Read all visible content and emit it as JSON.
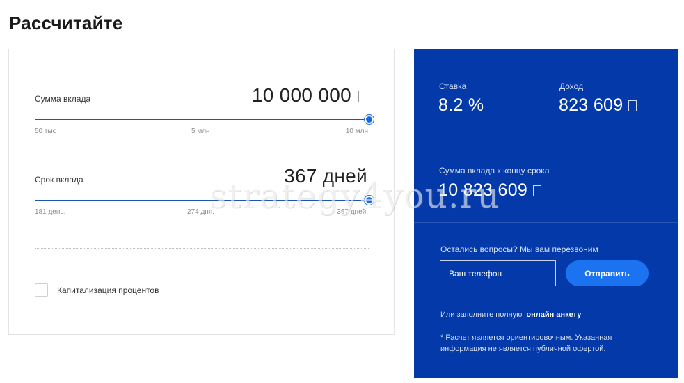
{
  "page": {
    "title": "Рассчитайте"
  },
  "deposit_amount": {
    "label": "Сумма вклада",
    "value": "10 000 000",
    "slider_fraction": 1.0,
    "ticks": [
      "50 тыс",
      "5 млн",
      "10 млн"
    ]
  },
  "deposit_term": {
    "label": "Срок вклада",
    "value": "367 дней",
    "slider_fraction": 1.0,
    "ticks": [
      "181 день.",
      "274 дня.",
      "367 дней."
    ]
  },
  "capitalization": {
    "label": "Капитализация процентов",
    "checked": false
  },
  "results": {
    "rate_label": "Ставка",
    "rate_value": "8.2 %",
    "income_label": "Доход",
    "income_value": "823 609",
    "total_label": "Сумма вклада к концу срока",
    "total_value": "10 823 609"
  },
  "callback": {
    "question": "Остались вопросы? Мы вам перезвоним",
    "phone_placeholder": "Ваш телефон",
    "send_label": "Отправить",
    "hint_text": "Или заполните полную",
    "hint_link": "онлайн анкету",
    "disclaimer": "* Расчет является ориентировочным. Указанная информация не является публичной офертой."
  },
  "watermark": "strategy4you.ru",
  "colors": {
    "panel": "#0339a8",
    "accent": "#1c73f2",
    "track": "#1d56b4"
  },
  "icons": {
    "currency": "ruble-sign-placeholder-icon"
  }
}
